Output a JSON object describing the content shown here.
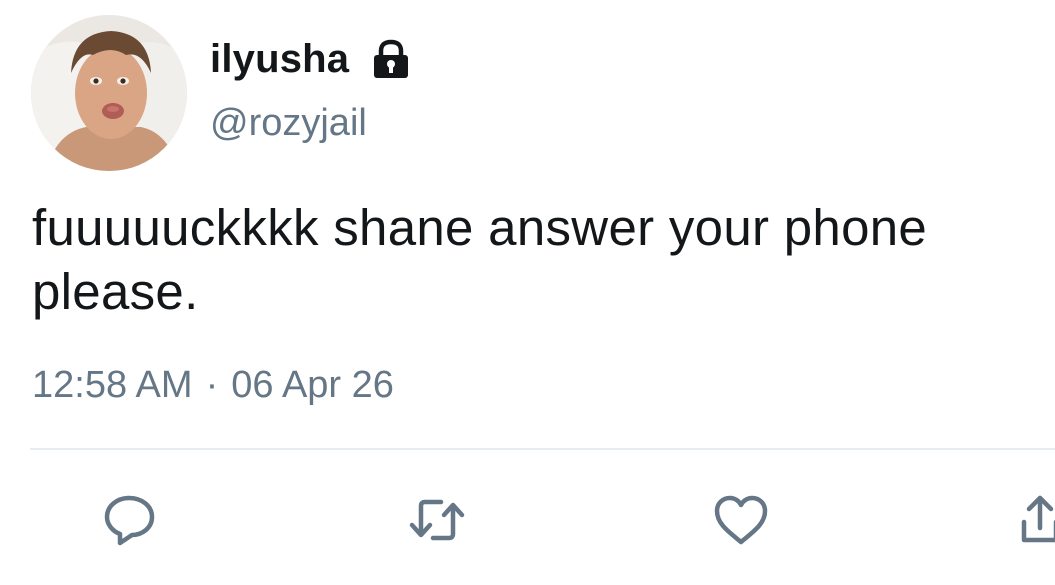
{
  "user": {
    "display_name": "ilyusha",
    "handle": "@rozyjail",
    "avatar_icon": "avatar",
    "protected_icon": "lock-icon"
  },
  "tweet": {
    "text": "fuuuuuckkkk shane answer your phone please.",
    "time": "12:58 AM",
    "separator": "·",
    "date": "06 Apr 26"
  },
  "actions": [
    {
      "icon": "reply-icon"
    },
    {
      "icon": "retweet-icon"
    },
    {
      "icon": "like-icon"
    },
    {
      "icon": "share-icon"
    }
  ],
  "colors": {
    "text": "#14171a",
    "secondary": "#657786",
    "icon": "#657786",
    "divider": "#e6ecf0"
  }
}
